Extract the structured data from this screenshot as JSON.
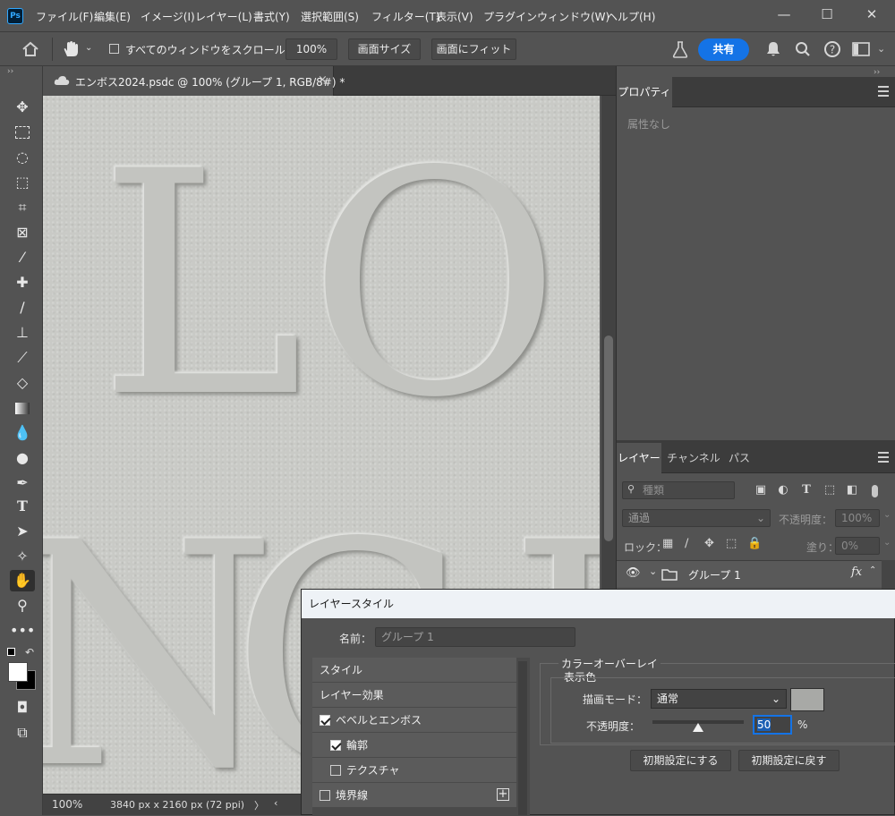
{
  "app": {
    "logo": "Ps"
  },
  "menu": [
    "ファイル(F)",
    "編集(E)",
    "イメージ(I)",
    "レイヤー(L)",
    "書式(Y)",
    "選択範囲(S)",
    "フィルター(T)",
    "表示(V)",
    "プラグイン",
    "ウィンドウ(W)",
    "ヘルプ(H)"
  ],
  "window_controls": {
    "minimize": "—",
    "maximize": "☐",
    "close": "✕"
  },
  "options": {
    "scroll_all_label": "すべてのウィンドウをスクロール",
    "zoom_value": "100%",
    "actual_size_label": "画面サイズ",
    "fit_label": "画面にフィット",
    "share_label": "共有",
    "accent": "#1473e6"
  },
  "document": {
    "tab_title": "エンボス2024.psdc @ 100% (グループ 1, RGB/8#) *",
    "close": "×",
    "canvas_letters": [
      "L",
      "O",
      "N",
      "C",
      "I"
    ]
  },
  "status": {
    "zoom": "100%",
    "dimensions": "3840 px x 2160 px (72 ppi)",
    "arrow": "〉",
    "left": "‹"
  },
  "properties_panel": {
    "tab": "プロパティ",
    "empty_text": "属性なし"
  },
  "layers_panel": {
    "tabs": [
      "レイヤー",
      "チャンネル",
      "パス"
    ],
    "filter_placeholder": "種類",
    "blend_mode": "通過",
    "opacity_label": "不透明度：",
    "opacity_value": "100%",
    "lock_label": "ロック：",
    "fill_label": "塗り：",
    "fill_value": "0%",
    "layer_name": "グループ 1",
    "fx": "fx"
  },
  "dialog": {
    "title": "レイヤースタイル",
    "name_label": "名前：",
    "name_value": "グループ 1",
    "styles": [
      {
        "label": "スタイル",
        "check": "none"
      },
      {
        "label": "レイヤー効果",
        "check": "none"
      },
      {
        "label": "ベベルとエンボス",
        "check": "on"
      },
      {
        "label": "輪郭",
        "check": "on"
      },
      {
        "label": "テクスチャ",
        "check": "off"
      },
      {
        "label": "境界線",
        "check": "off"
      }
    ],
    "section_title": "カラーオーバーレイ",
    "subsection": "表示色",
    "blend_label": "描画モード：",
    "blend_value": "通常",
    "swatch_color": "#a8a9a6",
    "opacity_label": "不透明度：",
    "opacity_value": "50",
    "opacity_fraction": 0.5,
    "percent": "%",
    "make_default": "初期設定にする",
    "reset_default": "初期設定に戻す",
    "add": "+"
  }
}
